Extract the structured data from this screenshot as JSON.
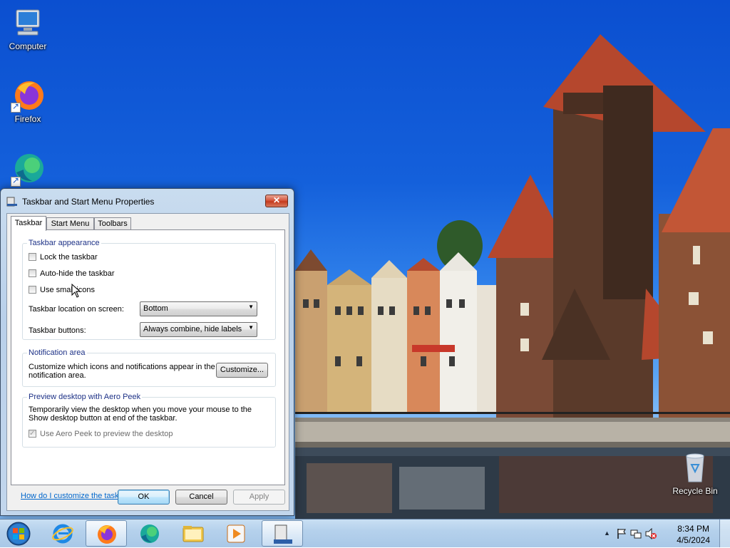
{
  "desktop": {
    "icons": [
      {
        "label": "Computer",
        "icon": "computer-icon"
      },
      {
        "label": "Firefox",
        "icon": "firefox-icon"
      },
      {
        "label": "",
        "icon": "edge-icon"
      },
      {
        "label": "Recycle Bin",
        "icon": "recycle-bin-icon"
      }
    ]
  },
  "dialog": {
    "title": "Taskbar and Start Menu Properties",
    "close_label": "✕",
    "tabs": [
      "Taskbar",
      "Start Menu",
      "Toolbars"
    ],
    "active_tab": "Taskbar",
    "appearance": {
      "title": "Taskbar appearance",
      "lock": {
        "label": "Lock the taskbar",
        "checked": false
      },
      "autohide": {
        "label": "Auto-hide the taskbar",
        "checked": false
      },
      "small_icons": {
        "label": "Use small icons",
        "checked": false
      },
      "location_label": "Taskbar location on screen:",
      "location_value": "Bottom",
      "buttons_label": "Taskbar buttons:",
      "buttons_value": "Always combine, hide labels"
    },
    "notification": {
      "title": "Notification area",
      "desc_line1": "Customize which icons and notifications appear in the",
      "desc_line2": "notification area.",
      "customize_label": "Customize..."
    },
    "aero_peek": {
      "title": "Preview desktop with Aero Peek",
      "desc_line1": "Temporarily view the desktop when you move your mouse to the",
      "desc_line2": "Show desktop button at end of the taskbar.",
      "checkbox_label": "Use Aero Peek to preview the desktop",
      "checked": true,
      "enabled": false
    },
    "help_link": "How do I customize the taskbar?",
    "ok_label": "OK",
    "cancel_label": "Cancel",
    "apply_label": "Apply"
  },
  "taskbar": {
    "items": [
      "start-orb-icon",
      "internet-explorer-icon",
      "firefox-icon",
      "edge-icon",
      "file-explorer-icon",
      "media-player-icon",
      "taskbar-properties-icon"
    ],
    "active_item": "taskbar-properties-icon",
    "tray": {
      "arrow": "▲",
      "time": "8:34 PM",
      "date": "4/5/2024"
    }
  },
  "colors": {
    "sky": "#1460db",
    "roof": "#b5472d",
    "brick": "#7a4a36",
    "water": "#3a4a5e",
    "link": "#0066cc"
  }
}
